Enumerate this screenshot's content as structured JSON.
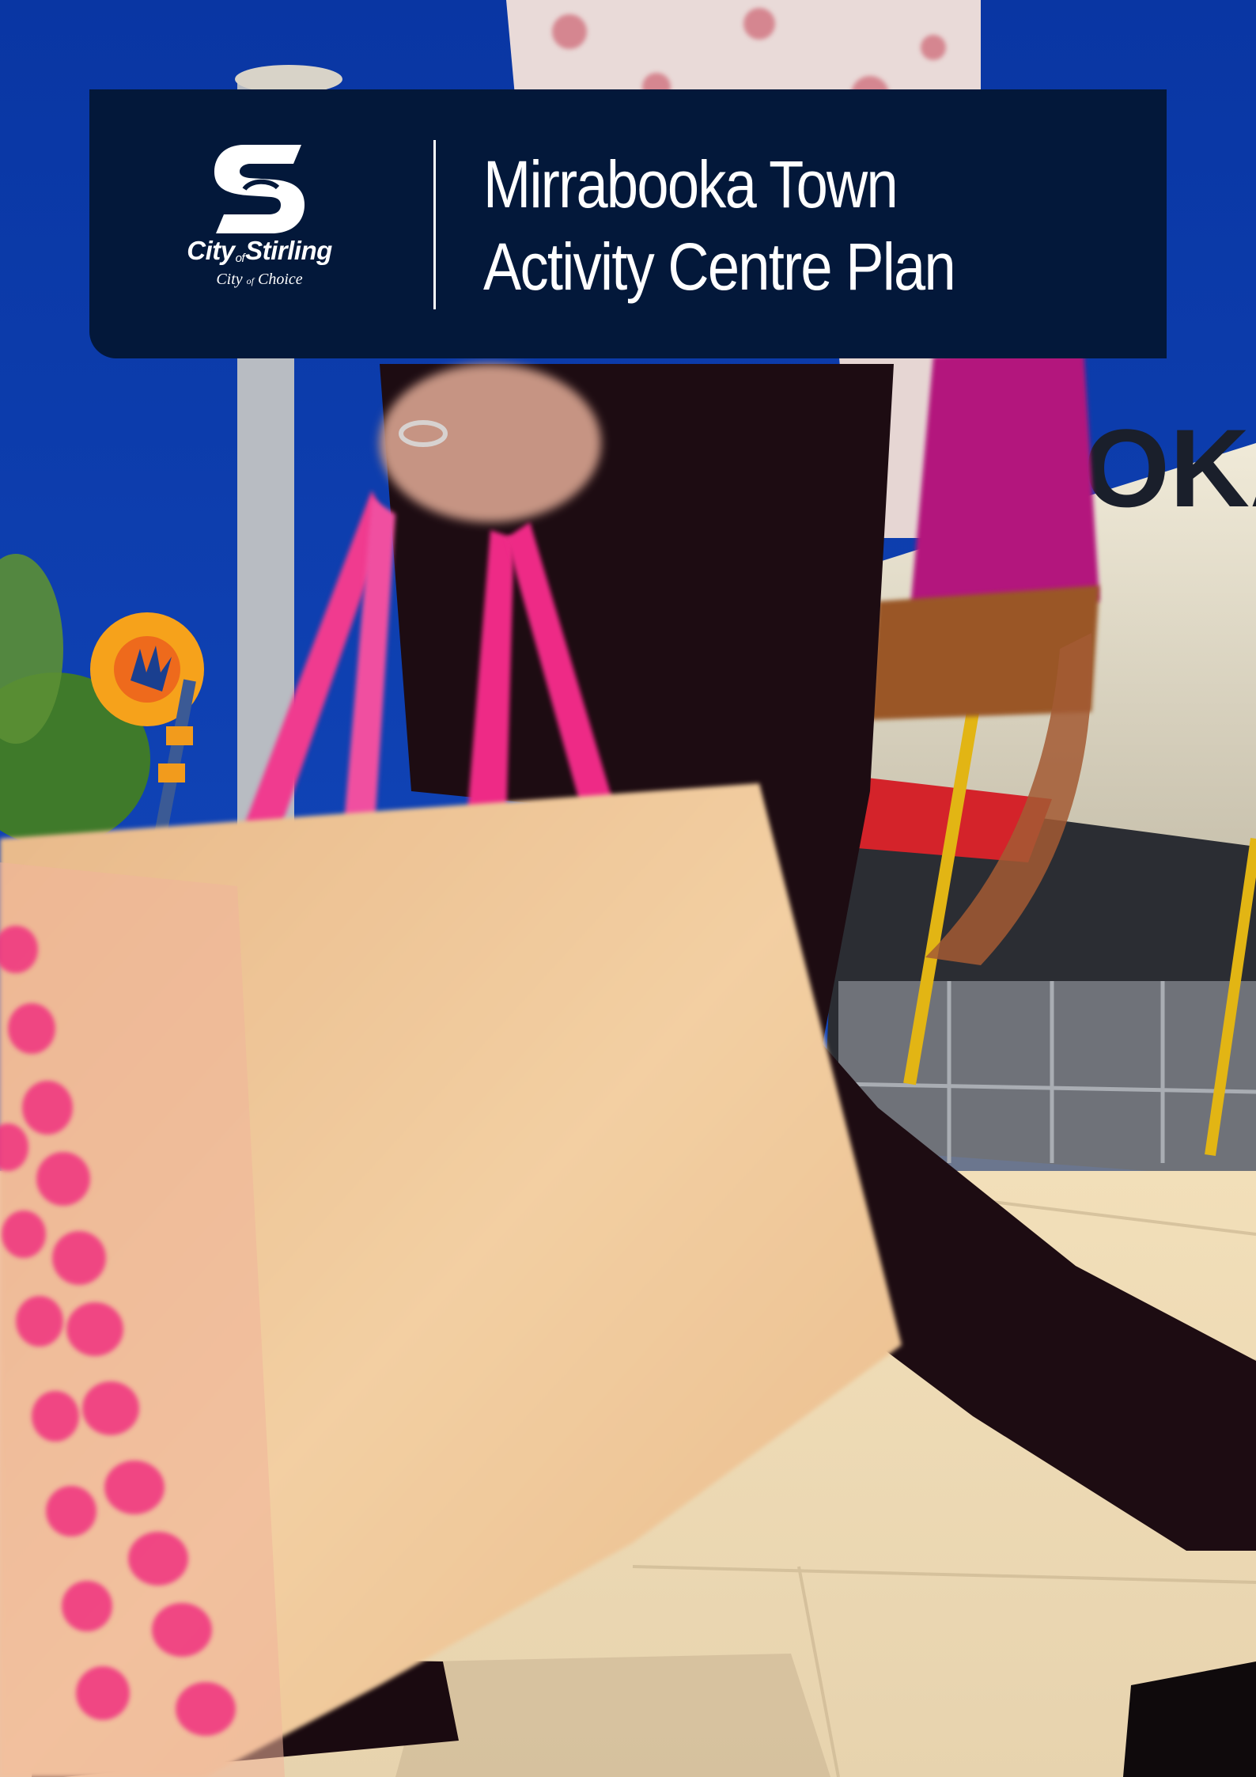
{
  "document": {
    "title_line_1": "Mirrabooka Town",
    "title_line_2": "Activity Centre Plan"
  },
  "logo": {
    "name_prefix": "City",
    "name_of": "of",
    "name_suffix": "Stirling",
    "tagline_prefix": "City",
    "tagline_of": "of",
    "tagline_suffix": "Choice"
  },
  "colors": {
    "banner": "#03183a",
    "sky": "#0a3fb0",
    "text": "#ffffff"
  }
}
